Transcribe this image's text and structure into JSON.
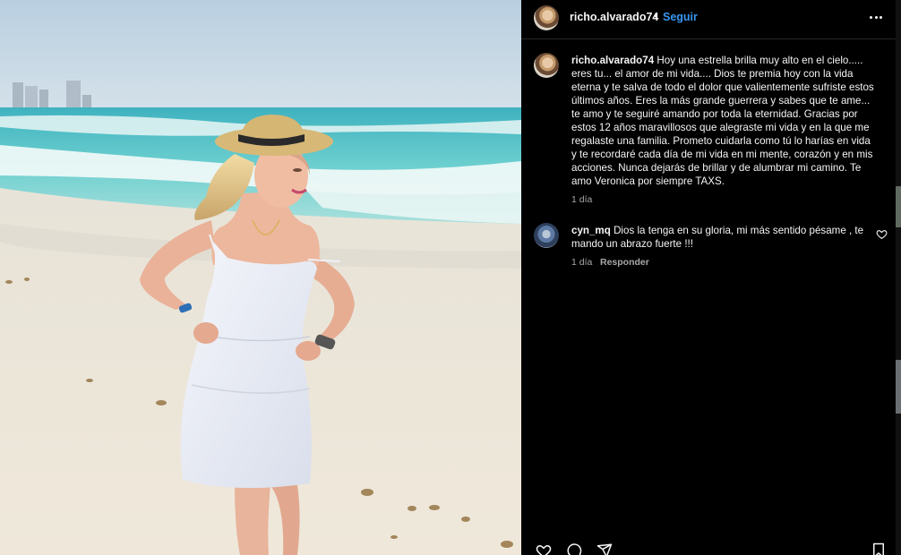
{
  "post": {
    "username": "richo.alvarado74",
    "separator": "•",
    "follow_label": "Seguir",
    "more_icon": "more-options-icon",
    "photo_description_icon": "beach-photo"
  },
  "caption": {
    "username": "richo.alvarado74",
    "text": "Hoy una estrella brilla muy alto en el cielo..... eres tu... el amor de mi vida.... Dios te premia hoy con la vida eterna y te salva de todo el dolor que valientemente sufriste estos últimos años. Eres la más grande guerrera y sabes que te ame... te amo y te seguiré amando por toda la eternidad. Gracias por estos 12 años maravillosos que alegraste mi vida y en la que me regalaste una familia. Prometo cuidarla como tú lo harías en vida y te recordaré cada día de mi vida en mi mente, corazón y en mis acciones. Nunca dejarás de brillar y de alumbrar mi camino. Te amo Veronica por siempre TAXS.",
    "time": "1 día"
  },
  "comments": [
    {
      "username": "cyn_mq",
      "text": "Dios la tenga en su gloria, mi más sentido pésame , te mando un abrazo fuerte !!!",
      "time": "1 día",
      "reply_label": "Responder"
    }
  ],
  "colors": {
    "background": "#000000",
    "link": "#3897f0",
    "muted": "#a8a8a8",
    "text": "#f5f5f5"
  }
}
